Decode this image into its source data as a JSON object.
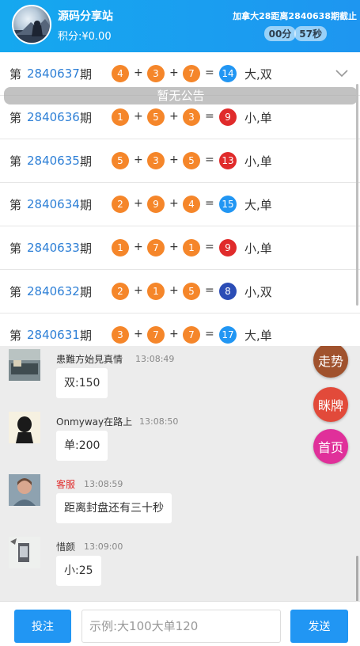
{
  "header": {
    "site_name": "源码分享站",
    "points": "积分:¥0.00",
    "countdown_text": "加拿大28距离2840638期截止",
    "minutes": "00分",
    "seconds": "57秒"
  },
  "results": {
    "di": "第",
    "qi": "期",
    "notice": "暂无公告",
    "rows": [
      {
        "issue": "2840637",
        "balls": [
          "4",
          "3",
          "7"
        ],
        "sum": "14",
        "result": "大,双"
      },
      {
        "issue": "2840636",
        "balls": [
          "1",
          "5",
          "3"
        ],
        "sum": "9",
        "result": "小,单"
      },
      {
        "issue": "2840635",
        "balls": [
          "5",
          "3",
          "5"
        ],
        "sum": "13",
        "result": "小,单"
      },
      {
        "issue": "2840634",
        "balls": [
          "2",
          "9",
          "4"
        ],
        "sum": "15",
        "result": "大,单"
      },
      {
        "issue": "2840633",
        "balls": [
          "1",
          "7",
          "1"
        ],
        "sum": "9",
        "result": "小,单"
      },
      {
        "issue": "2840632",
        "balls": [
          "2",
          "1",
          "5"
        ],
        "sum": "8",
        "result": "小,双"
      },
      {
        "issue": "2840631",
        "balls": [
          "3",
          "7",
          "7"
        ],
        "sum": "17",
        "result": "大,单"
      }
    ],
    "plus": "+",
    "equals": "="
  },
  "chat": {
    "messages": [
      {
        "name": "患難方始見真情",
        "time": "13:08:49",
        "text": "双:150"
      },
      {
        "name": "Onmyway在路上",
        "time": "13:08:50",
        "text": "单:200"
      },
      {
        "name": "客服",
        "time": "13:08:59",
        "text": "距离封盘还有三十秒"
      },
      {
        "name": "惜颜",
        "time": "13:09:00",
        "text": "小:25"
      }
    ]
  },
  "fabs": {
    "trend": "走势",
    "squeeze": "眯牌",
    "home": "首页"
  },
  "footer": {
    "bet_label": "投注",
    "input_placeholder": "示例:大100大单120",
    "send_label": "发送"
  },
  "colors": {
    "primary": "#2196f3",
    "orange_ball": "#f5862a",
    "red_ball": "#e02b2b",
    "navy_ball": "#2b4db6"
  }
}
